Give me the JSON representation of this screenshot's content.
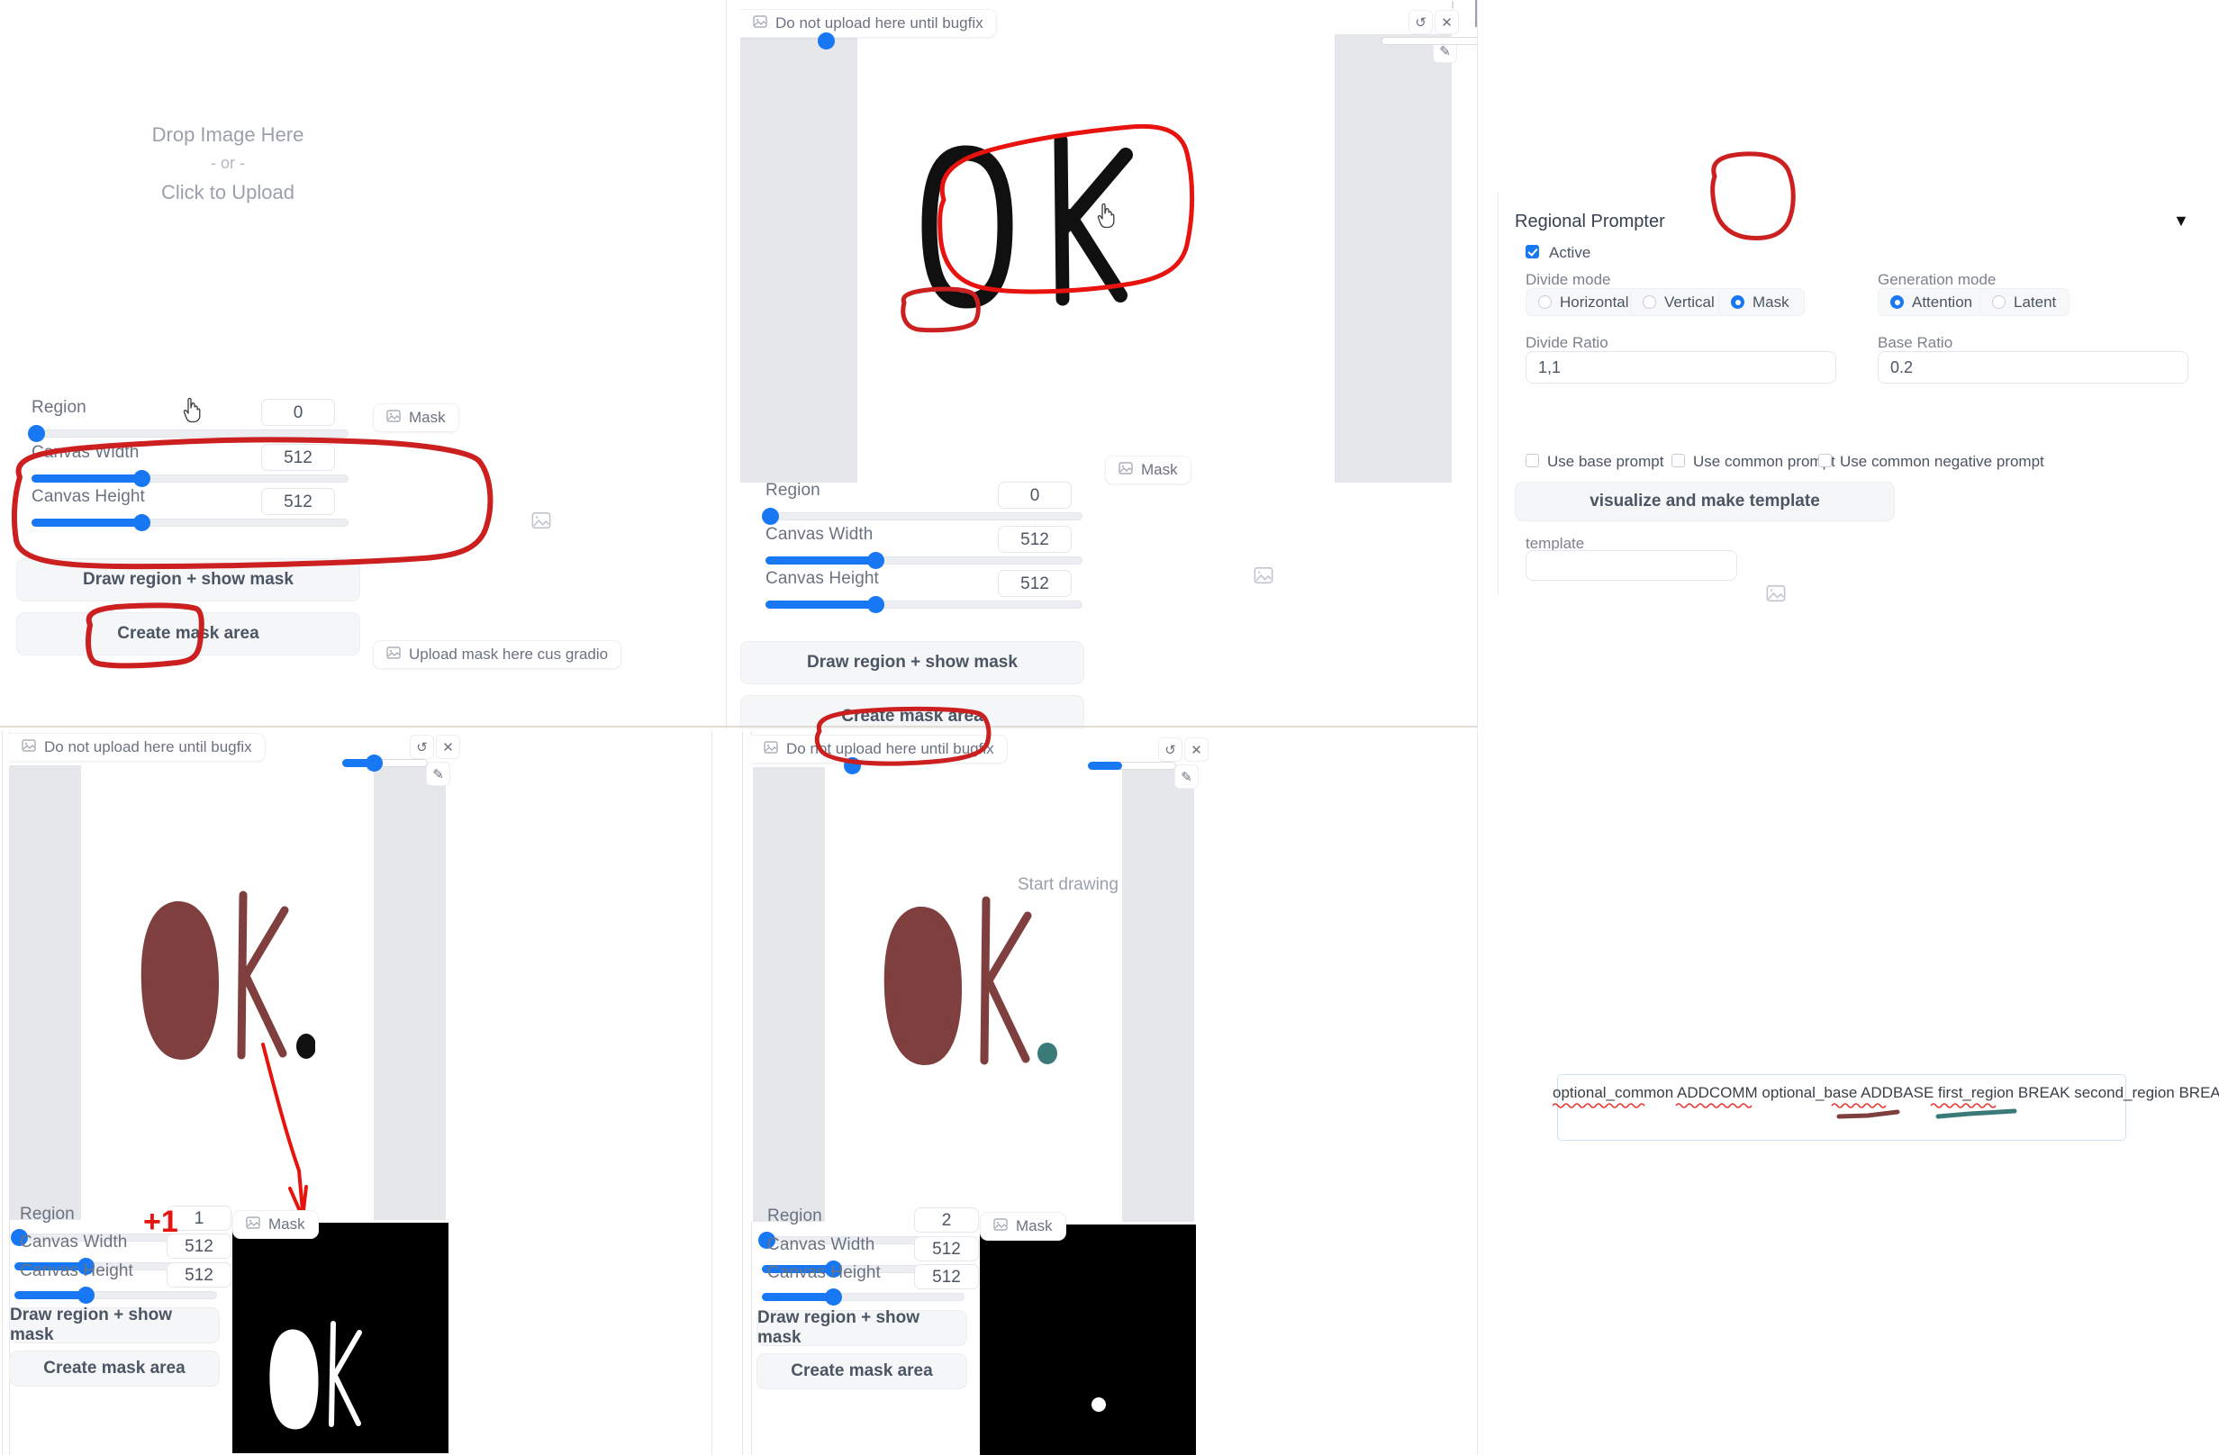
{
  "colors": {
    "accent_blue": "#1877f2",
    "markup_red": "#cc1f1f",
    "arrow_red": "#e8120e",
    "brush_brown": "#7e3f3e",
    "dot_black": "#111111",
    "dot_teal": "#3a7a78",
    "mask_bg": "#000000",
    "panel_bg": "#ffffff"
  },
  "panel_topleft": {
    "dropzone": {
      "line1": "Drop Image Here",
      "line2": "- or -",
      "line3": "Click to Upload"
    },
    "region": {
      "label": "Region",
      "value": "0"
    },
    "canvas_width": {
      "label": "Canvas Width",
      "value": "512"
    },
    "canvas_height": {
      "label": "Canvas Height",
      "value": "512"
    },
    "draw_button": "Draw region + show mask",
    "create_button": "Create mask area",
    "mask_chip": "Mask",
    "upload_chip": "Upload mask here cus gradio"
  },
  "panel_topmid": {
    "upload_chip": "Do not upload here until bugfix",
    "region": {
      "label": "Region",
      "value": "0"
    },
    "canvas_width": {
      "label": "Canvas Width",
      "value": "512"
    },
    "canvas_height": {
      "label": "Canvas Height",
      "value": "512"
    },
    "draw_button": "Draw region + show mask",
    "create_button": "Create mask area",
    "mask_chip": "Mask",
    "tools": {
      "undo": "undo-icon",
      "clear": "close-icon",
      "brush": "brush-icon"
    },
    "drawing": "OK"
  },
  "panel_bottomleft": {
    "upload_chip": "Do not upload here until bugfix",
    "region": {
      "label": "Region",
      "value": "1"
    },
    "canvas_width": {
      "label": "Canvas Width",
      "value": "512"
    },
    "canvas_height": {
      "label": "Canvas Height",
      "value": "512"
    },
    "draw_button": "Draw region + show mask",
    "create_button": "Create mask area",
    "mask_chip": "Mask",
    "annotation_plus": "+1",
    "drawing": "OK."
  },
  "panel_bottommid": {
    "upload_chip": "Do not upload here until bugfix",
    "placeholder": "Start drawing",
    "region": {
      "label": "Region",
      "value": "2"
    },
    "canvas_width": {
      "label": "Canvas Width",
      "value": "512"
    },
    "canvas_height": {
      "label": "Canvas Height",
      "value": "512"
    },
    "draw_button": "Draw region + show mask",
    "create_button": "Create mask area",
    "mask_chip": "Mask",
    "drawing": "OK."
  },
  "regional_prompter": {
    "title": "Regional Prompter",
    "collapse_caret": "▼",
    "active": {
      "label": "Active",
      "checked": true
    },
    "divide_mode": {
      "label": "Divide mode",
      "options": [
        "Horizontal",
        "Vertical",
        "Mask"
      ],
      "selected": "Mask"
    },
    "generation_mode": {
      "label": "Generation mode",
      "options": [
        "Attention",
        "Latent"
      ],
      "selected": "Attention"
    },
    "divide_ratio": {
      "label": "Divide Ratio",
      "value": "1,1"
    },
    "base_ratio": {
      "label": "Base Ratio",
      "value": "0.2"
    },
    "checkboxes": [
      {
        "label": "Use base prompt",
        "checked": false
      },
      {
        "label": "Use common prompt",
        "checked": false
      },
      {
        "label": "Use common negative prompt",
        "checked": false
      }
    ],
    "visualize_button": "visualize and make template",
    "template": {
      "label": "template",
      "value": ""
    }
  },
  "prompt_field": {
    "text": "optional_common ADDCOMM optional_base ADDBASE first_region BREAK second_region BREAK ..."
  }
}
